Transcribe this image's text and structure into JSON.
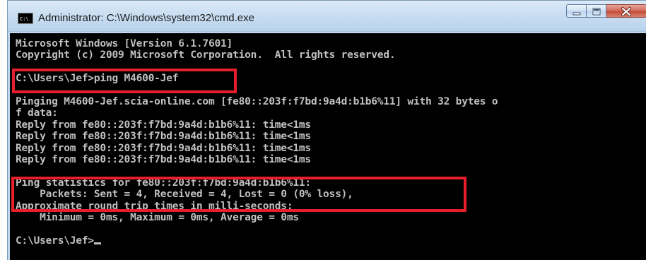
{
  "window": {
    "title": "Administrator: C:\\Windows\\system32\\cmd.exe",
    "icon": "cmd-icon",
    "controls": {
      "minimize": "minimize-icon",
      "maximize": "maximize-icon",
      "close": "close-icon"
    }
  },
  "console": {
    "lines": [
      "Microsoft Windows [Version 6.1.7601]",
      "Copyright (c) 2009 Microsoft Corporation.  All rights reserved.",
      "",
      "C:\\Users\\Jef>ping M4600-Jef",
      "",
      "Pinging M4600-Jef.scia-online.com [fe80::203f:f7bd:9a4d:b1b6%11] with 32 bytes o",
      "f data:",
      "Reply from fe80::203f:f7bd:9a4d:b1b6%11: time<1ms",
      "Reply from fe80::203f:f7bd:9a4d:b1b6%11: time<1ms",
      "Reply from fe80::203f:f7bd:9a4d:b1b6%11: time<1ms",
      "Reply from fe80::203f:f7bd:9a4d:b1b6%11: time<1ms",
      "",
      "Ping statistics for fe80::203f:f7bd:9a4d:b1b6%11:",
      "    Packets: Sent = 4, Received = 4, Lost = 0 (0% loss),",
      "Approximate round trip times in milli-seconds:",
      "    Minimum = 0ms, Maximum = 0ms, Average = 0ms",
      "",
      "C:\\Users\\Jef>"
    ]
  },
  "colors": {
    "console_background": "#000000",
    "console_text": "#c0c0c0",
    "highlight": "#e5202a"
  }
}
